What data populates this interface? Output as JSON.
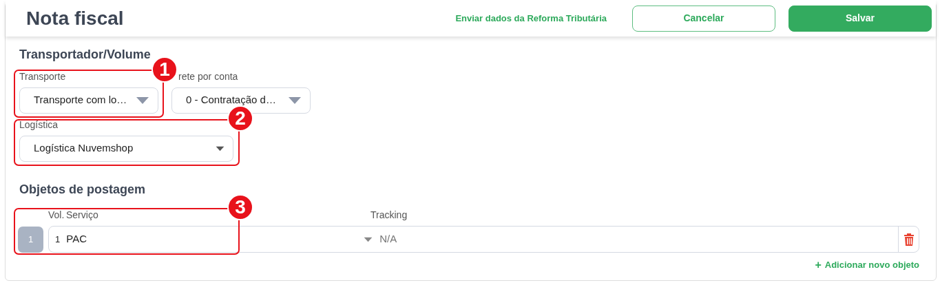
{
  "header": {
    "title": "Nota fiscal",
    "link": "Enviar dados da Reforma Tributária",
    "buttons": [
      {
        "label": "Cancelar",
        "kind": "outline"
      },
      {
        "label": "Salvar",
        "kind": "primary"
      }
    ]
  },
  "transport": {
    "heading": "Transportador/Volume",
    "fields": [
      {
        "label": "Transporte",
        "value": "Transporte com lo…",
        "kind": "select-big"
      },
      {
        "label": "rete por conta",
        "value": "0 - Contratação d…",
        "kind": "select-big"
      },
      {
        "label": "Logística",
        "value": "Logística Nuvemshop",
        "kind": "select-wide"
      }
    ]
  },
  "objects": {
    "heading": "Objetos de postagem",
    "columns": [
      "Vol.",
      "Serviço",
      "Tracking"
    ],
    "rows": [
      {
        "index": "1",
        "vol": "1",
        "service": "PAC",
        "tracking_placeholder": "N/A"
      }
    ],
    "add_icon": "+",
    "add_link": "Adicionar novo objeto"
  },
  "annotations": [
    {
      "number": "1"
    },
    {
      "number": "2"
    },
    {
      "number": "3"
    }
  ]
}
